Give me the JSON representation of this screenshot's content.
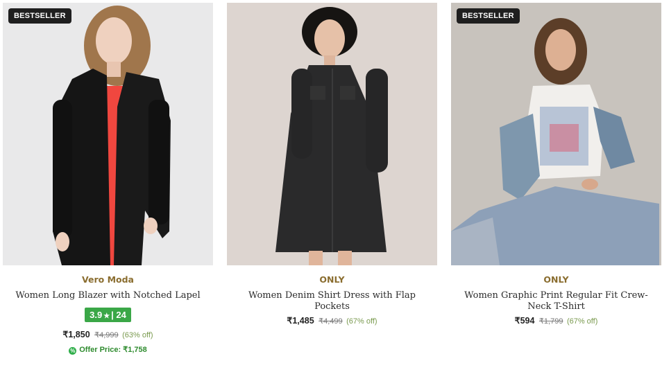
{
  "products": [
    {
      "badge": "BESTSELLER",
      "brand": "Vero Moda",
      "title": "Women Long Blazer with Notched Lapel",
      "rating": "3.9",
      "rating_count": "24",
      "price": "₹1,850",
      "mrp": "₹4,999",
      "discount": "(63% off)",
      "offer": "Offer Price: ₹1,758"
    },
    {
      "brand": "ONLY",
      "title": "Women Denim Shirt Dress with Flap Pockets",
      "price": "₹1,485",
      "mrp": "₹4,499",
      "discount": "(67% off)"
    },
    {
      "badge": "BESTSELLER",
      "brand": "ONLY",
      "title": "Women Graphic Print Regular Fit Crew-Neck T-Shirt",
      "price": "₹594",
      "mrp": "₹1,799",
      "discount": "(67% off)"
    }
  ],
  "icons": {
    "rating_star": "star-icon",
    "offer": "offer-tag-icon"
  },
  "colors": {
    "brand_text": "#8a6d2f",
    "rating_bg": "#3aa747",
    "badge_bg": "#1f1f1f",
    "offer_text": "#2e8b2e"
  }
}
